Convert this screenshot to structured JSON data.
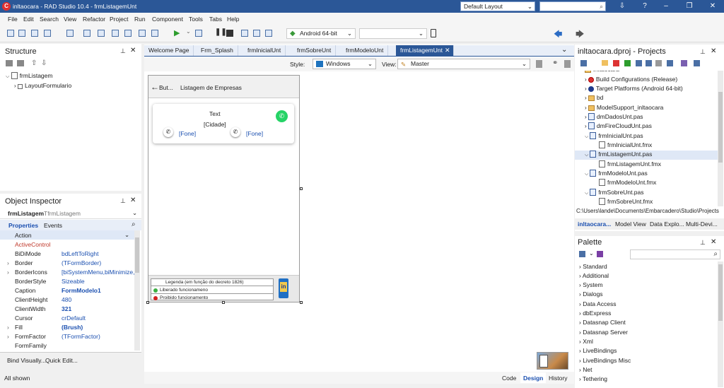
{
  "window": {
    "title": "inltaocara - RAD Studio 10.4 - frmListagemUnt",
    "layout": "Default Layout",
    "search_icon": "⌕"
  },
  "menu": [
    "File",
    "Edit",
    "Search",
    "View",
    "Refactor",
    "Project",
    "Run",
    "Component",
    "Tools",
    "Tabs",
    "Help"
  ],
  "toolbar": {
    "platform": "Android 64-bit"
  },
  "structure": {
    "title": "Structure",
    "root": "frmListagem",
    "child": "LayoutFormulario"
  },
  "inspector": {
    "title": "Object Inspector",
    "object": "frmListagem",
    "object_type": "TfrmListagem",
    "tab_properties": "Properties",
    "tab_events": "Events",
    "rows": [
      {
        "k": "Action",
        "v": ""
      },
      {
        "k": "ActiveControl",
        "v": ""
      },
      {
        "k": "BiDiMode",
        "v": "bdLeftToRight"
      },
      {
        "k": "Border",
        "v": "(TFormBorder)"
      },
      {
        "k": "BorderIcons",
        "v": "[biSystemMenu,biMinimize,b"
      },
      {
        "k": "BorderStyle",
        "v": "Sizeable"
      },
      {
        "k": "Caption",
        "v": "FormModelo1"
      },
      {
        "k": "ClientHeight",
        "v": "480"
      },
      {
        "k": "ClientWidth",
        "v": "321"
      },
      {
        "k": "Cursor",
        "v": "crDefault"
      },
      {
        "k": "Fill",
        "v": "(Brush)"
      },
      {
        "k": "FormFactor",
        "v": "(TFormFactor)"
      },
      {
        "k": "FormFamily",
        "v": ""
      }
    ],
    "bind_visually": "Bind Visually...",
    "quick_edit": "Quick Edit...",
    "all_shown": "All shown"
  },
  "tabs": [
    "Welcome Page",
    "Frm_Splash",
    "frmInicialUnt",
    "frmSobreUnt",
    "frmModeloUnt",
    "frmListagemUnt"
  ],
  "stylebar": {
    "style_label": "Style:",
    "style": "Windows",
    "view_label": "View:",
    "view": "Master"
  },
  "form": {
    "back": "But...",
    "header_title": "Listagem de Empresas",
    "card_text": "Text",
    "card_city": "[Cidade]",
    "phone1": "[Fone]",
    "phone2": "[Fone]",
    "legend_title": "Legenda (em função do decreto 1826)",
    "legend_ok": "Liberado funcionameno",
    "legend_no": "Proibido funcionamento"
  },
  "bottom_tabs": {
    "code": "Code",
    "design": "Design",
    "history": "History"
  },
  "projects": {
    "title": "inltaocara.dproj - Projects",
    "items": [
      {
        "label": "inltaocara",
        "icon": "folder",
        "indent": 1
      },
      {
        "label": "Build Configurations (Release)",
        "icon": "build",
        "indent": 1
      },
      {
        "label": "Target Platforms (Android 64-bit)",
        "icon": "target",
        "indent": 1
      },
      {
        "label": "bd",
        "icon": "folder",
        "indent": 1
      },
      {
        "label": "ModelSupport_inltaocara",
        "icon": "folder",
        "indent": 1
      },
      {
        "label": "dmDadosUnt.pas",
        "icon": "pas",
        "indent": 1
      },
      {
        "label": "dmFireCloudUnt.pas",
        "icon": "pas",
        "indent": 1
      },
      {
        "label": "frmInicialUnt.pas",
        "icon": "pas",
        "indent": 1
      },
      {
        "label": "frmInicialUnt.fmx",
        "icon": "file",
        "indent": 2
      },
      {
        "label": "frmListagemUnt.pas",
        "icon": "pas",
        "indent": 1
      },
      {
        "label": "frmListagemUnt.fmx",
        "icon": "file",
        "indent": 2
      },
      {
        "label": "frmModeloUnt.pas",
        "icon": "pas",
        "indent": 1
      },
      {
        "label": "frmModeloUnt.fmx",
        "icon": "file",
        "indent": 2
      },
      {
        "label": "frmSobreUnt.pas",
        "icon": "pas",
        "indent": 1
      },
      {
        "label": "frmSobreUnt.fmx",
        "icon": "file",
        "indent": 2
      }
    ],
    "path": "C:\\Users\\lande\\Documents\\Embarcadero\\Studio\\Projects",
    "tabs": [
      "inltaocara...",
      "Model View",
      "Data Explo...",
      "Multi-Devi..."
    ]
  },
  "palette": {
    "title": "Palette",
    "items": [
      "Standard",
      "Additional",
      "System",
      "Dialogs",
      "Data Access",
      "dbExpress",
      "Datasnap Client",
      "Datasnap Server",
      "Xml",
      "LiveBindings",
      "LiveBindings Misc",
      "Net",
      "Tethering"
    ]
  },
  "colors": {
    "accent": "#2b5797",
    "whatsapp": "#25d366",
    "green": "#3cb043",
    "red": "#d42020"
  }
}
